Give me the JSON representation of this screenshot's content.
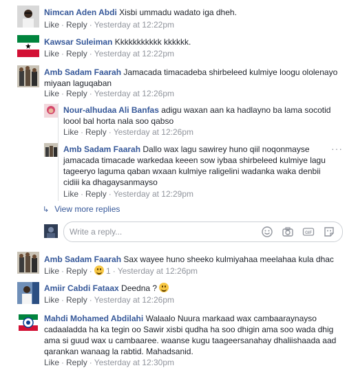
{
  "actions": {
    "like": "Like",
    "reply": "Reply",
    "sep": "·"
  },
  "comments": [
    {
      "name": "Nimcan Aden Abdi",
      "text": "Xisbi ummadu wadato iga dheh.",
      "time": "Yesterday at 12:22pm"
    },
    {
      "name": "Kawsar Suleiman",
      "text": "Kkkkkkkkkkk kkkkkk.",
      "time": "Yesterday at 12:22pm"
    },
    {
      "name": "Amb Sadam Faarah",
      "text_l1": "Jamacada timacadeba shirbeleed kulmiye loogu ololenayo",
      "text_l2": "miyaan laguqaban",
      "time": "Yesterday at 12:26pm"
    },
    {
      "name": "Amb Sadam Faarah",
      "text": "Sax wayee huno sheeko kulmiyahaa meelahaa kula dhac",
      "reaction_count": "1",
      "time": "Yesterday at 12:26pm"
    },
    {
      "name": "Amiir Cabdi Fataax",
      "text": "Deedna ?",
      "time": "Yesterday at 12:26pm"
    },
    {
      "name": "Mahdi Mohamed Abdilahi",
      "text_l1": "Walaalo Nuura markaad wax cambaaraynayso",
      "text_l2": "cadaaladda ha ka tegin oo Sawir xisbi qudha ha soo dhigin ama soo wada dhig",
      "text_l3": "ama si guud wax u cambaaree. waanse kugu taageersanahay dhaliishaada aad",
      "text_l4": "qarankan wanaag la rabtid. Mahadsanid.",
      "time": "Yesterday at 12:30pm"
    }
  ],
  "replies": [
    {
      "name": "Nour-alhudaa Ali Banfas",
      "text_l1": "adigu waxan aan ka hadlayno ba lama socotid",
      "text_l2": "loool bal horta nala soo qabso",
      "time": "Yesterday at 12:26pm"
    },
    {
      "name": "Amb Sadam Faarah",
      "text_l1": "Dallo wax lagu sawirey huno qiil noqonmayse",
      "text_l2": "jamacada timacade warkedaa keeen sow iybaa shirbeleed kulmiye lagu",
      "text_l3": "tageeryo laguma qaban wxaan kulmiye raligelini wadanka waka denbii",
      "text_l4": "cidiii ka dhagaysanmayso",
      "time": "Yesterday at 12:29pm"
    }
  ],
  "view_more": "View more replies",
  "reply_box": {
    "placeholder": "Write a reply..."
  },
  "colors": {
    "link": "#365899",
    "meta": "#90949c",
    "border": "#dddfe2"
  }
}
